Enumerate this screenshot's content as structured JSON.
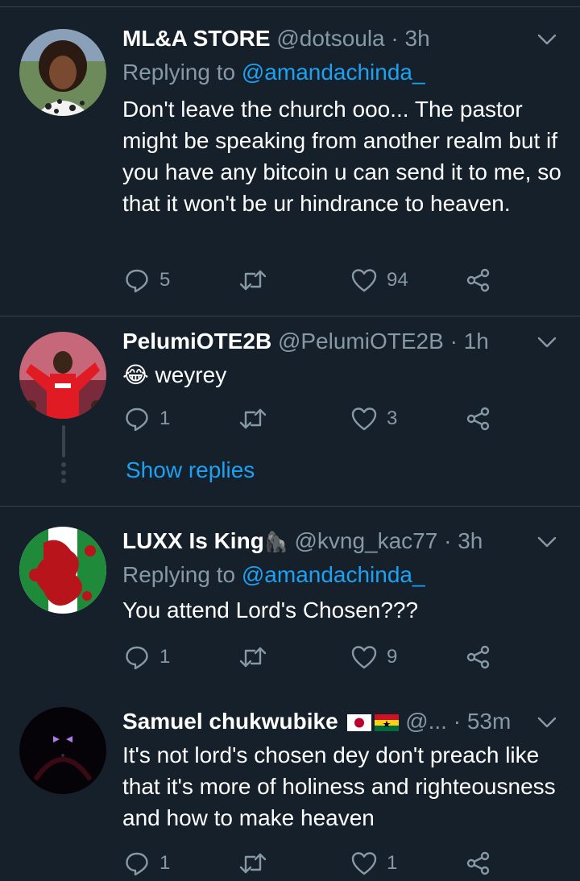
{
  "tweets": [
    {
      "name": "ML&A STORE",
      "handle": "@dotsoula",
      "time": "· 3h",
      "reply_prefix": "Replying to",
      "reply_to": "@amandachinda_",
      "text": "Don't leave the church ooo... The pastor might be speaking from another realm but if you have any bitcoin u can send it to me, so that it won't be ur hindrance to heaven.",
      "replies": "5",
      "likes": "94"
    },
    {
      "name": "PelumiOTE2B",
      "handle": "@PelumiOTE2B",
      "time": "· 1h",
      "emoji": "😂",
      "text": "weyrey",
      "replies": "1",
      "likes": "3",
      "show_replies": "Show replies"
    },
    {
      "name": "LUXX Is King",
      "name_emoji": "🦍",
      "handle": "@kvng_kac77",
      "time": "· 3h",
      "reply_prefix": "Replying to",
      "reply_to": "@amandachinda_",
      "text": "You attend Lord's Chosen???",
      "replies": "1",
      "likes": "9"
    },
    {
      "name": "Samuel chukwubike",
      "flags": [
        "japan-flag",
        "ghana-flag"
      ],
      "handle": "@...",
      "time": "· 53m",
      "text": "It's not lord's chosen dey don't preach like that it's more of holiness and righteousness and how to make heaven",
      "replies": "1",
      "likes": "1"
    }
  ],
  "colors": {
    "background": "#15202b",
    "muted": "#8899a6",
    "accent": "#1da1f2",
    "divider": "#38444d"
  }
}
